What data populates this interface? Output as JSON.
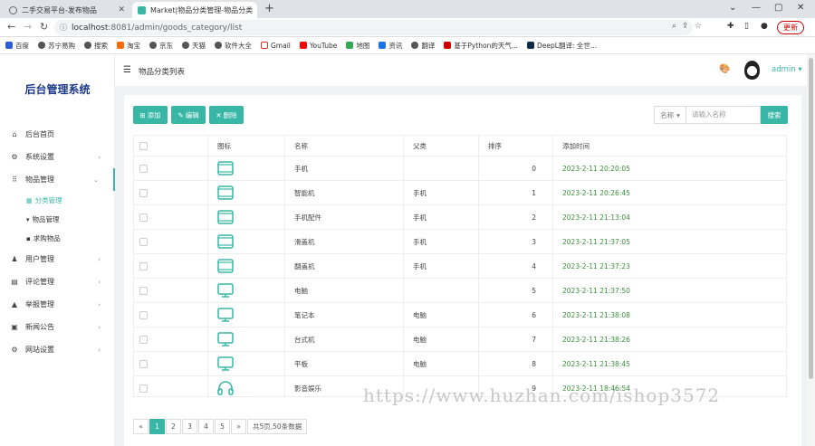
{
  "browser": {
    "tabs": [
      {
        "title": "二手交易平台-发布物品",
        "active": false
      },
      {
        "title": "Market|物品分类管理-物品分类",
        "active": true
      }
    ],
    "url_host": "localhost",
    "url_rest": ":8081/admin/goods_category/list",
    "update_label": "更新",
    "bookmarks": [
      "百度",
      "苏宁易购",
      "搜索",
      "淘宝",
      "京东",
      "天猫",
      "软件大全",
      "Gmail",
      "YouTube",
      "地图",
      "资讯",
      "翻译",
      "基于Python的天气...",
      "DeepL翻译: 全世..."
    ]
  },
  "sidebar": {
    "brand": "后台管理系统",
    "items": [
      {
        "label": "后台首页",
        "icon": "home-icon",
        "glyph": "⌂",
        "has_children": false
      },
      {
        "label": "系统设置",
        "icon": "gear-icon",
        "glyph": "⚙",
        "has_children": true
      },
      {
        "label": "物品管理",
        "icon": "grid-icon",
        "glyph": "⠿",
        "has_children": true,
        "open": true
      },
      {
        "label": "用户管理",
        "icon": "users-icon",
        "glyph": "👥",
        "has_children": true
      },
      {
        "label": "评论管理",
        "icon": "comment-icon",
        "glyph": "▤",
        "has_children": true
      },
      {
        "label": "举报管理",
        "icon": "warning-icon",
        "glyph": "▲",
        "has_children": true
      },
      {
        "label": "新闻公告",
        "icon": "news-icon",
        "glyph": "▣",
        "has_children": true
      },
      {
        "label": "网站设置",
        "icon": "cog-icon",
        "glyph": "⚙",
        "has_children": true
      }
    ],
    "subitems": [
      {
        "label": "分类管理",
        "icon": "list-icon",
        "glyph": "▦",
        "active": true
      },
      {
        "label": "物品管理",
        "icon": "cart-icon",
        "glyph": "🛒",
        "active": false
      },
      {
        "label": "求购物品",
        "icon": "card-icon",
        "glyph": "▪",
        "active": false
      }
    ]
  },
  "header": {
    "page_title": "物品分类列表",
    "user": "admin"
  },
  "toolbar": {
    "add_label": "添加",
    "edit_label": "编辑",
    "delete_label": "删除",
    "search_field_label": "名称",
    "search_placeholder": "请输入名称",
    "search_button": "搜索"
  },
  "table": {
    "columns": [
      "图标",
      "名称",
      "父类",
      "排序",
      "添加时间"
    ],
    "rows": [
      {
        "icon": "tablet",
        "name": "手机",
        "parent": "",
        "sort": "0",
        "time": "2023-2-11 20:20:05"
      },
      {
        "icon": "tablet",
        "name": "智能机",
        "parent": "手机",
        "sort": "1",
        "time": "2023-2-11 20:26:45"
      },
      {
        "icon": "tablet",
        "name": "手机配件",
        "parent": "手机",
        "sort": "2",
        "time": "2023-2-11 21:13:04"
      },
      {
        "icon": "tablet",
        "name": "滑盖机",
        "parent": "手机",
        "sort": "3",
        "time": "2023-2-11 21:37:05"
      },
      {
        "icon": "tablet",
        "name": "翻盖机",
        "parent": "手机",
        "sort": "4",
        "time": "2023-2-11 21:37:23"
      },
      {
        "icon": "monitor",
        "name": "电脑",
        "parent": "",
        "sort": "5",
        "time": "2023-2-11 21:37:50"
      },
      {
        "icon": "monitor",
        "name": "笔记本",
        "parent": "电脑",
        "sort": "6",
        "time": "2023-2-11 21:38:08"
      },
      {
        "icon": "monitor",
        "name": "台式机",
        "parent": "电脑",
        "sort": "7",
        "time": "2023-2-11 21:38:26"
      },
      {
        "icon": "monitor",
        "name": "平板",
        "parent": "电脑",
        "sort": "8",
        "time": "2023-2-11 21:38:45"
      },
      {
        "icon": "headphones",
        "name": "影音娱乐",
        "parent": "",
        "sort": "9",
        "time": "2023-2-11 18:46:54"
      }
    ]
  },
  "pagination": {
    "prev": "«",
    "pages": [
      "1",
      "2",
      "3",
      "4",
      "5"
    ],
    "current": "1",
    "next": "»",
    "info": "共5页,50条数据"
  },
  "watermark": "https://www.huzhan.com/ishop3572",
  "colors": {
    "accent": "#39b7a6",
    "brand": "#1f3a8a",
    "time": "#3a8f3a"
  }
}
